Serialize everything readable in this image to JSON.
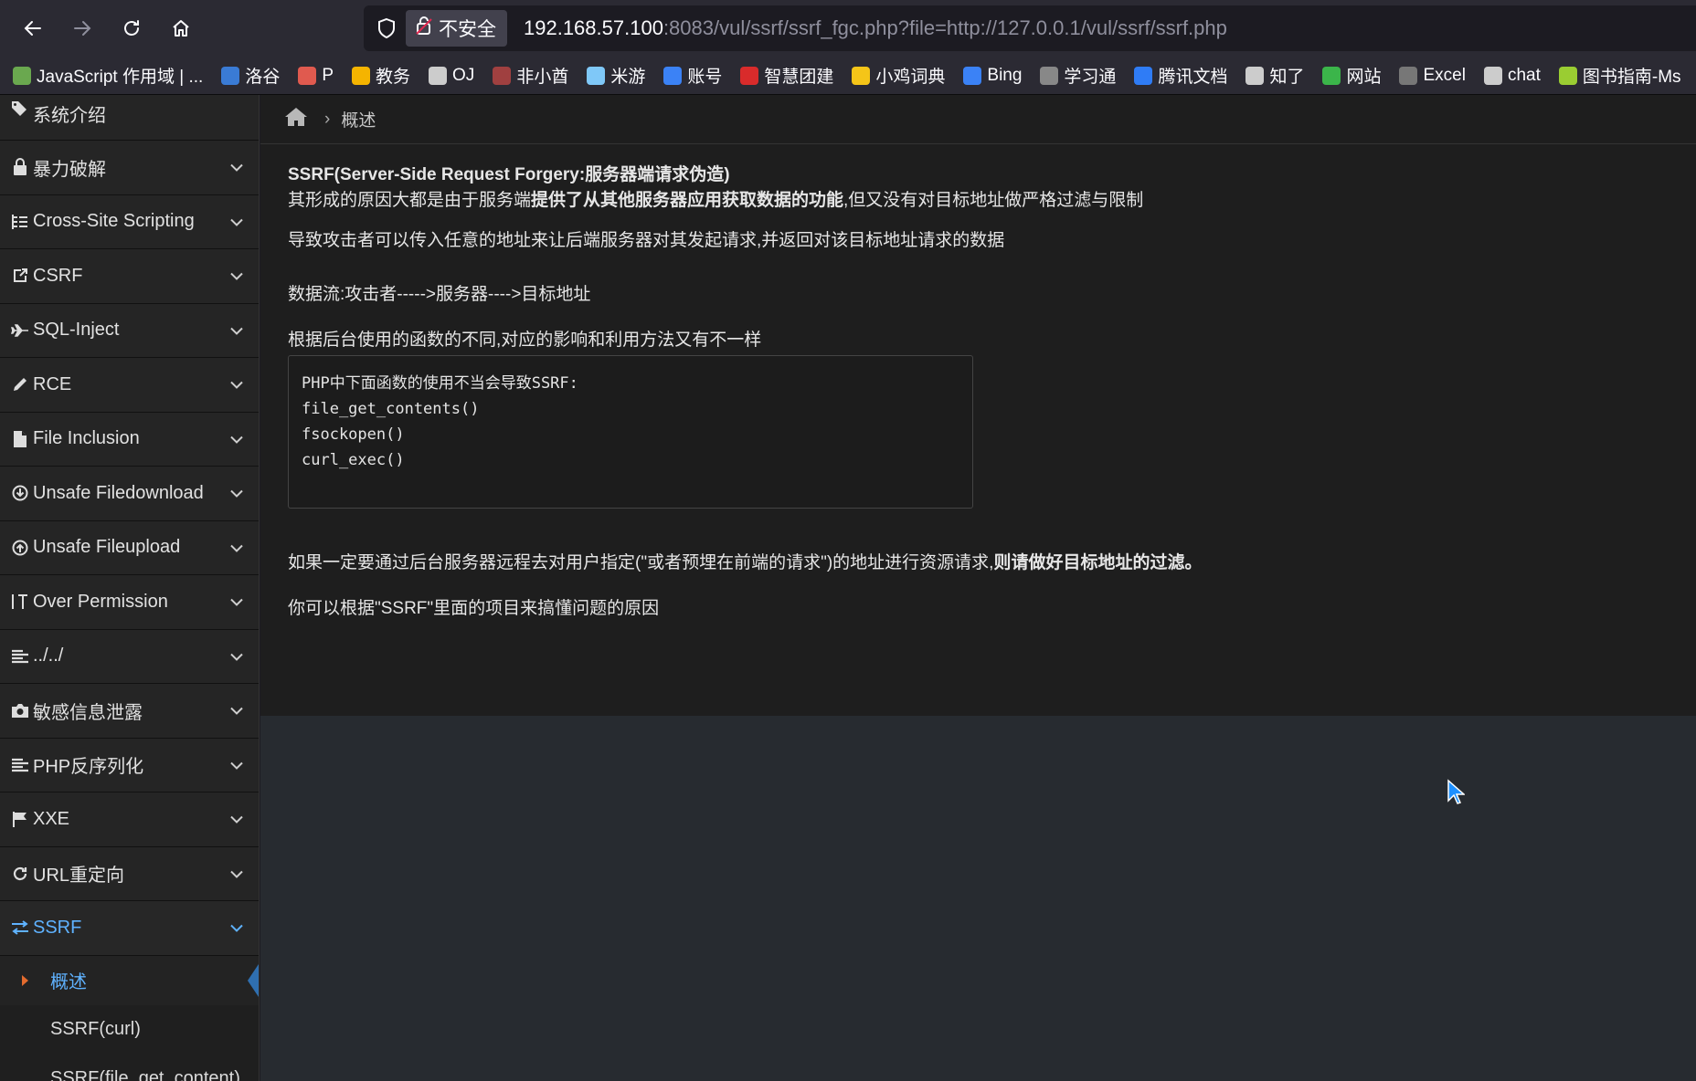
{
  "browser": {
    "security_label": "不安全",
    "url_host": "192.168.57.100",
    "url_rest": ":8083/vul/ssrf/ssrf_fgc.php?file=http://127.0.0.1/vul/ssrf/ssrf.php",
    "icons": [
      "back-icon",
      "forward-icon",
      "reload-icon",
      "home-icon",
      "shield-icon",
      "lock-warning-icon"
    ]
  },
  "bookmarks": [
    {
      "label": "JavaScript 作用域 | ...",
      "color": "#6aa84f"
    },
    {
      "label": "洛谷",
      "color": "#3a7bd5"
    },
    {
      "label": "P",
      "color": "#e05a4f"
    },
    {
      "label": "教务",
      "color": "#f5b400"
    },
    {
      "label": "OJ",
      "color": "#cccccc"
    },
    {
      "label": "非小酋",
      "color": "#a04040"
    },
    {
      "label": "米游",
      "color": "#7fc8f8"
    },
    {
      "label": "账号",
      "color": "#3b82f6"
    },
    {
      "label": "智慧团建",
      "color": "#d92b2b"
    },
    {
      "label": "小鸡词典",
      "color": "#f5c518"
    },
    {
      "label": "Bing",
      "color": "#3b82f6"
    },
    {
      "label": "学习通",
      "color": "#888888"
    },
    {
      "label": "腾讯文档",
      "color": "#2f7cf6"
    },
    {
      "label": "知了",
      "color": "#cccccc"
    },
    {
      "label": "网站",
      "color": "#3bb54a"
    },
    {
      "label": "Excel",
      "color": "#777777"
    },
    {
      "label": "chat",
      "color": "#cccccc"
    },
    {
      "label": "图书指南-Ms",
      "color": "#9acd32"
    }
  ],
  "sidebar": {
    "items": [
      {
        "label": "系统介绍",
        "icon": "tags-icon"
      },
      {
        "label": "暴力破解",
        "icon": "lock-icon"
      },
      {
        "label": "Cross-Site Scripting",
        "icon": "list-tree-icon"
      },
      {
        "label": "CSRF",
        "icon": "share-icon"
      },
      {
        "label": "SQL-Inject",
        "icon": "plane-icon"
      },
      {
        "label": "RCE",
        "icon": "pencil-icon"
      },
      {
        "label": "File Inclusion",
        "icon": "file-icon"
      },
      {
        "label": "Unsafe Filedownload",
        "icon": "download-icon"
      },
      {
        "label": "Unsafe Fileupload",
        "icon": "upload-icon"
      },
      {
        "label": "Over Permission",
        "icon": "text-height-icon"
      },
      {
        "label": "../../",
        "icon": "align-left-icon"
      },
      {
        "label": "敏感信息泄露",
        "icon": "camera-icon"
      },
      {
        "label": "PHP反序列化",
        "icon": "align-left-icon"
      },
      {
        "label": "XXE",
        "icon": "flag-icon"
      },
      {
        "label": "URL重定向",
        "icon": "refresh-icon"
      },
      {
        "label": "SSRF",
        "icon": "exchange-icon"
      }
    ],
    "sub_items": [
      "概述",
      "SSRF(curl)",
      "SSRF(file_get_content)"
    ]
  },
  "breadcrumb": {
    "current": "概述"
  },
  "content": {
    "title": "SSRF(Server-Side Request Forgery:服务器端请求伪造)",
    "line1_pre": "其形成的原因大都是由于服务端",
    "line1_bold": "提供了从其他服务器应用获取数据的功能",
    "line1_post": ",但又没有对目标地址做严格过滤与限制",
    "line2": "导致攻击者可以传入任意的地址来让后端服务器对其发起请求,并返回对该目标地址请求的数据",
    "line3": "数据流:攻击者----->服务器---->目标地址",
    "line4": "根据后台使用的函数的不同,对应的影响和利用方法又有不一样",
    "code": [
      "PHP中下面函数的使用不当会导致SSRF:",
      "file_get_contents()",
      "fsockopen()",
      "curl_exec()"
    ],
    "line5_pre": "如果一定要通过后台服务器远程去对用户指定(\"或者预埋在前端的请求\")的地址进行资源请求,",
    "line5_bold": "则请做好目标地址的过滤",
    "line5_post": "。",
    "line6": "你可以根据\"SSRF\"里面的项目来搞懂问题的原因"
  }
}
